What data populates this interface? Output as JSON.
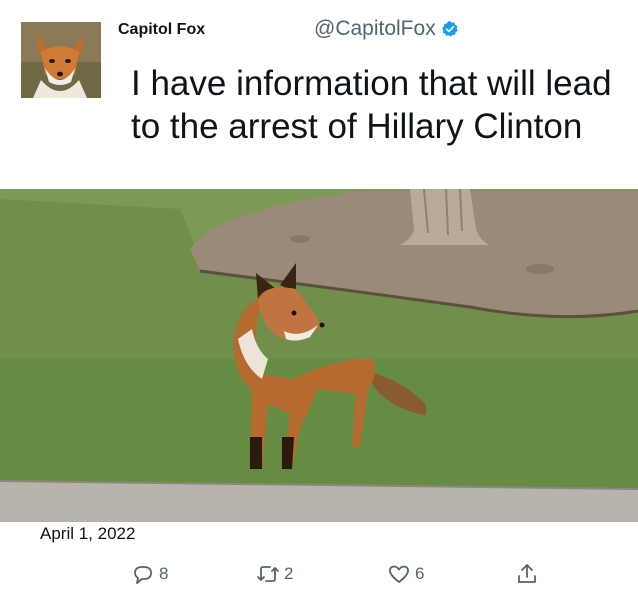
{
  "author": {
    "display_name": "Capitol Fox",
    "handle": "@CapitolFox",
    "verified": true,
    "avatar_icon": "fox-avatar"
  },
  "tweet": {
    "text": "I have information that will lead to the arrest of Hillary Clinton",
    "photo": "red fox standing on grass beside a dirt tree bed",
    "date": "April 1, 2022"
  },
  "actions": {
    "reply": {
      "icon": "reply-icon",
      "count": "8"
    },
    "retweet": {
      "icon": "retweet-icon",
      "count": "2"
    },
    "like": {
      "icon": "heart-icon",
      "count": "6"
    },
    "share": {
      "icon": "share-icon"
    }
  },
  "colors": {
    "text": "#0f1419",
    "secondary": "#53646f",
    "verified": "#1d9bf0",
    "background": "#ffffff"
  }
}
